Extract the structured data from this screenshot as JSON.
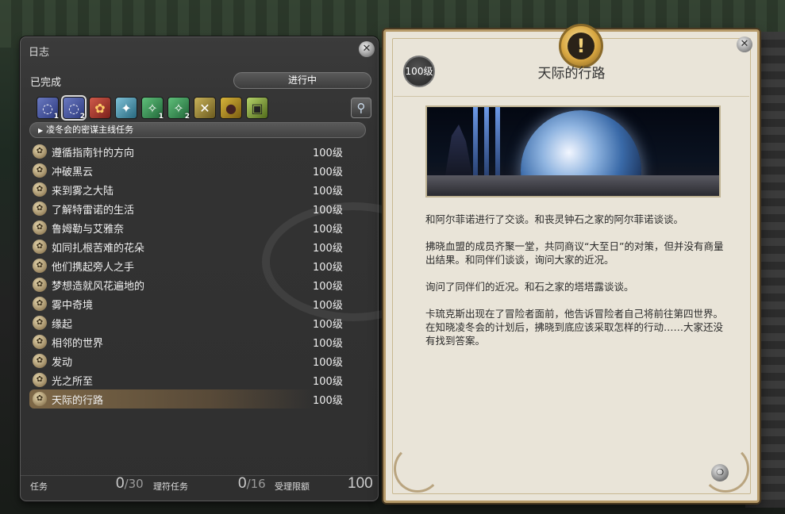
{
  "journal": {
    "title": "日志",
    "tab_done": "已完成",
    "tab_in_progress": "进行中",
    "filters": [
      {
        "icon": "main-scenario-icon",
        "glyph": "◌",
        "sub": "1"
      },
      {
        "icon": "main-scenario-icon",
        "glyph": "◌",
        "sub": "2"
      },
      {
        "icon": "feature-quest-icon",
        "glyph": "✿",
        "sub": ""
      },
      {
        "icon": "side-quest-icon",
        "glyph": "✦",
        "sub": ""
      },
      {
        "icon": "leve-icon",
        "glyph": "✧",
        "sub": "1"
      },
      {
        "icon": "leve-icon",
        "glyph": "✧",
        "sub": "2"
      },
      {
        "icon": "battle-icon",
        "glyph": "✕",
        "sub": ""
      },
      {
        "icon": "gathering-icon",
        "glyph": "●",
        "sub": ""
      },
      {
        "icon": "misc-icon",
        "glyph": "▣",
        "sub": ""
      }
    ],
    "category": "凌冬会的密谋主线任务",
    "quests": [
      {
        "name": "遵循指南针的方向",
        "level": "100级",
        "selected": false
      },
      {
        "name": "冲破黑云",
        "level": "100级",
        "selected": false
      },
      {
        "name": "来到雾之大陆",
        "level": "100级",
        "selected": false
      },
      {
        "name": "了解特雷诺的生活",
        "level": "100级",
        "selected": false
      },
      {
        "name": "鲁姆勒与艾雅奈",
        "level": "100级",
        "selected": false
      },
      {
        "name": "如同扎根苦难的花朵",
        "level": "100级",
        "selected": false
      },
      {
        "name": "他们携起旁人之手",
        "level": "100级",
        "selected": false
      },
      {
        "name": "梦想造就风花遍地的",
        "level": "100级",
        "selected": false
      },
      {
        "name": "雾中奇境",
        "level": "100级",
        "selected": false
      },
      {
        "name": "缘起",
        "level": "100级",
        "selected": false
      },
      {
        "name": "相邻的世界",
        "level": "100级",
        "selected": false
      },
      {
        "name": "发动",
        "level": "100级",
        "selected": false
      },
      {
        "name": "光之所至",
        "level": "100级",
        "selected": false
      },
      {
        "name": "天际的行路",
        "level": "100级",
        "selected": true
      }
    ],
    "footer": {
      "quests_label": "任务",
      "quests_count": "0",
      "quests_max": "/30",
      "guildleve_label": "理符任务",
      "guildleve_count": "0",
      "guildleve_max": "/16",
      "allowance_label": "受理限额",
      "allowance_value": "100"
    }
  },
  "detail": {
    "level_badge": "100级",
    "title": "天际的行路",
    "paragraphs": [
      "和阿尔菲诺进行了交谈。和丧灵钟石之家的阿尔菲诺谈谈。",
      "拂晓血盟的成员齐聚一堂，共同商议“大至日”的对策，但并没有商量出结果。和同伴们谈谈，询问大家的近况。",
      "询问了同伴们的近况。和石之家的塔塔露谈谈。",
      "卡琉克斯出现在了冒险者面前，他告诉冒险者自己将前往第四世界。在知晓凌冬会的计划后，拂晓到底应该采取怎样的行动……大家还没有找到答案。"
    ]
  },
  "colors": {
    "journal_bg": "#333333",
    "detail_bg": "#e9e4d8",
    "gold_border": "#b79b6a",
    "selected_row": "#be965a"
  }
}
